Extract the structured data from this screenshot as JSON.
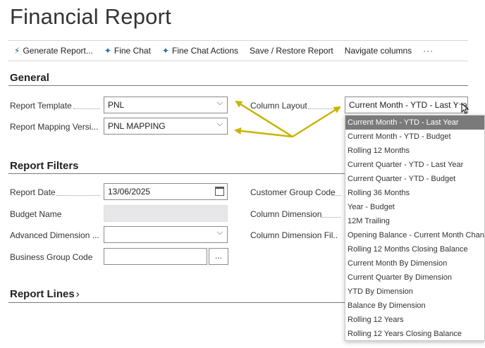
{
  "page": {
    "title": "Financial Report"
  },
  "toolbar": {
    "generate": "Generate Report...",
    "fine_chat": "Fine Chat",
    "fine_chat_actions": "Fine Chat Actions",
    "save_restore": "Save / Restore Report",
    "navigate_columns": "Navigate columns",
    "more": "···"
  },
  "general": {
    "title": "General",
    "report_template_label": "Report Template",
    "report_template_value": "PNL",
    "report_mapping_label": "Report Mapping Versi...",
    "report_mapping_value": "PNL MAPPING",
    "column_layout_label": "Column Layout",
    "column_layout_value": "Current Month - YTD - Last Yea"
  },
  "filters": {
    "title": "Report Filters",
    "report_date_label": "Report Date",
    "report_date_value": "13/06/2025",
    "budget_name_label": "Budget Name",
    "budget_name_value": "",
    "advanced_dimension_label": "Advanced Dimension ...",
    "advanced_dimension_value": "",
    "business_group_label": "Business Group Code",
    "business_group_value": "",
    "business_group_more": "...",
    "customer_group_label": "Customer Group Code",
    "column_dimension_label": "Column Dimension",
    "column_dimension_filter_label": "Column Dimension Fil..."
  },
  "report_lines": {
    "title": "Report Lines",
    "chevron": "›"
  },
  "column_layout_options": [
    "Current Month - YTD - Last Year",
    "Current Month - YTD - Budget",
    "Rolling 12 Months",
    "Current Quarter - YTD - Last Year",
    "Current Quarter - YTD - Budget",
    "Rolling 36 Months",
    "Year - Budget",
    "12M Trailing",
    "Opening Balance - Current Month Change",
    "Rolling 12 Months Closing Balance",
    "Current Month By Dimension",
    "Current Quarter By Dimension",
    "YTD By Dimension",
    "Balance By Dimension",
    "Rolling 12 Years",
    "Rolling 12 Years Closing Balance"
  ],
  "colors": {
    "arrow": "#c8b400",
    "selected_bg": "#7a7a7a",
    "rule": "#7a7a7a"
  },
  "icons": {
    "generate": "lightning-icon",
    "fine_chat": "sparkle-icon",
    "chevron": "chevron-down-icon",
    "calendar": "calendar-icon",
    "cursor": "mouse-pointer-icon"
  }
}
